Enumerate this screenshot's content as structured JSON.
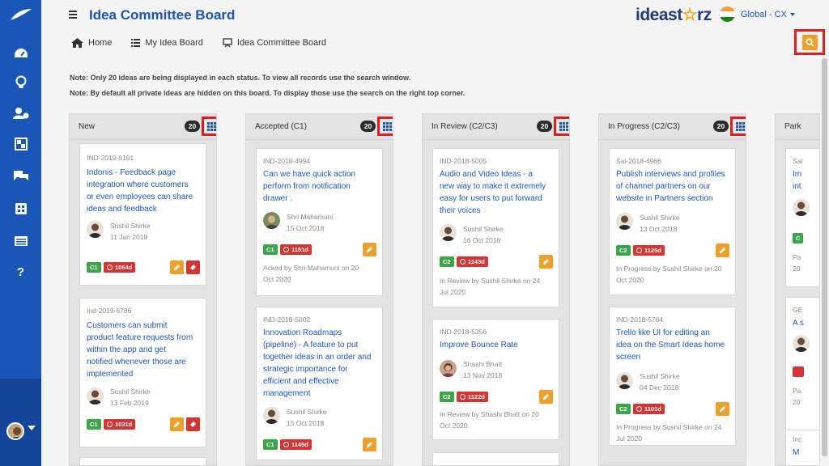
{
  "header": {
    "title": "Idea Committee Board",
    "brand_text_1": "ideast",
    "brand_star": "☆",
    "brand_text_2": "rz",
    "region": "Global - CX"
  },
  "breadcrumb": [
    {
      "label": "Home",
      "icon": "home-icon"
    },
    {
      "label": "My Idea Board",
      "icon": "list-icon"
    },
    {
      "label": "Idea Committee Board",
      "icon": "board-icon"
    }
  ],
  "notes": [
    "Note: Only 20 ideas are being displayed in each status. To view all records use the search window.",
    "Note: By default all private ideas are hidden on this board. To display those use the search on the right top corner."
  ],
  "sidebar": {
    "icons": [
      "dashboard-icon",
      "lightbulb-icon",
      "users-icon",
      "widgets-icon",
      "chat-icon",
      "grid-icon",
      "table-icon",
      "help-icon"
    ],
    "help_label": "?"
  },
  "colors": {
    "primary": "#1a56b8",
    "accent": "#f0a02a",
    "danger": "#d63333",
    "success": "#3aa648",
    "highlight": "#e01e1e"
  },
  "columns": [
    {
      "title": "New",
      "count": "20",
      "cards": [
        {
          "id": "IND-2019-6191",
          "title_lines": [
            "Indonis - Feedback page",
            "integration where customers",
            "or even employees can share",
            "ideas and feedback"
          ],
          "author": "Sushil Shirke",
          "date": "11 Jan 2019",
          "stage": "C1",
          "age": "1064d",
          "footer": ""
        },
        {
          "id": "Ind-2019-6786",
          "title_lines": [
            "Customers can submit",
            "product feature requests from",
            "within the app and get",
            "notified whenever those are",
            "implemented"
          ],
          "author": "Sushil Shirke",
          "date": "13 Feb 2019",
          "stage": "C1",
          "age": "1031d",
          "footer": ""
        }
      ]
    },
    {
      "title": "Accepted (C1)",
      "count": "20",
      "cards": [
        {
          "id": "IND-2018-4994",
          "title_lines": [
            "Can we have quick action",
            "perform from notification",
            "drawer ."
          ],
          "author": "Shri Mahamuni",
          "date": "15 Oct 2018",
          "stage": "C1",
          "age": "1151d",
          "footer_lines": [
            "Acked by Shri Mahamuni on 20",
            "Oct 2020"
          ]
        },
        {
          "id": "IND-2018-5002",
          "title_lines": [
            "Innovation Roadmaps",
            "(pipeline) - A feature to put",
            "together ideas in an order and",
            "strategic importance for",
            "efficient and effective",
            "management"
          ],
          "author": "Sushil Shirke",
          "date": "15 Oct 2018",
          "stage": "C1",
          "age": "1145d",
          "footer_lines": []
        }
      ]
    },
    {
      "title": "In Review (C2/C3)",
      "count": "20",
      "cards": [
        {
          "id": "IND-2018-5005",
          "title_lines": [
            "Audio and Video Ideas - a",
            "new way to make it extremely",
            "easy for users to put forward",
            "their voices"
          ],
          "author": "Sushil Shirke",
          "date": "16 Oct 2018",
          "stage": "C2",
          "age": "1143d",
          "footer_lines": [
            "In Review by Sushil Shirke on 24",
            "Jul 2020"
          ]
        },
        {
          "id": "IND-2018-5356",
          "title_lines": [
            "Improve Bounce Rate"
          ],
          "author": "Shashi Bhatt",
          "date": "13 Nov 2018",
          "stage": "C2",
          "age": "1122d",
          "footer_lines": [
            "In Review by Shashi Bhatt on 20",
            "Oct 2020"
          ]
        }
      ]
    },
    {
      "title": "In Progress (C2/C3)",
      "count": "20",
      "cards": [
        {
          "id": "Sal-2018-4966",
          "title_lines": [
            "Publish interviews and profiles",
            "of channel partners on our",
            "website in Partners section"
          ],
          "author": "Sushil Shirke",
          "date": "13 Oct 2018",
          "stage": "C2",
          "age": "1125d",
          "footer_lines": [
            "In Progress by Sushil Shirke on 20",
            "Oct 2020"
          ]
        },
        {
          "id": "IND-2018-5764",
          "title_lines": [
            "Trello like UI for editing an",
            "idea on the Smart Ideas home",
            "screen"
          ],
          "author": "Sushil Shirke",
          "date": "04 Dec 2018",
          "stage": "C2",
          "age": "1101d",
          "footer_lines": [
            "In Progress by Sushil Shirke on 24",
            "Jul 2020"
          ]
        }
      ]
    },
    {
      "title": "Park",
      "partial_cards": [
        {
          "id": "Sal",
          "title_lines": [
            "Im",
            "int"
          ],
          "stage": "C",
          "footer_lines": [
            "Pa",
            "20"
          ]
        },
        {
          "id": "GE",
          "title_lines": [
            "A s"
          ],
          "footer_lines": [
            "Pa",
            "20"
          ]
        },
        {
          "id": "Inc",
          "title_lines": [
            "M"
          ]
        }
      ]
    }
  ]
}
